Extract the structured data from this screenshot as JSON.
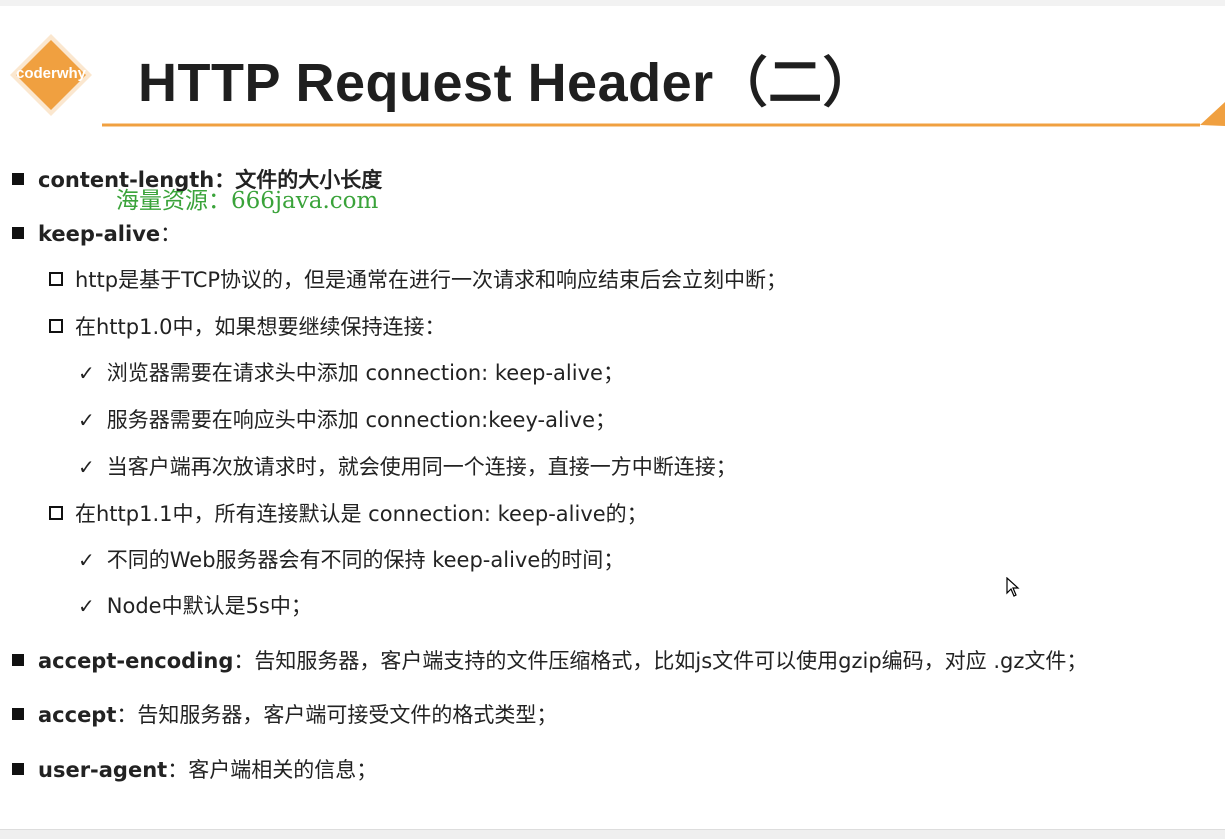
{
  "slide": {
    "logo_text": "coderwhy",
    "title": "HTTP Request Header（二）",
    "watermark": "海量资源：666java.com"
  },
  "items": {
    "content_length": {
      "key": "content-length",
      "desc": "：文件的大小长度"
    },
    "keep_alive": {
      "key": "keep-alive",
      "desc": "："
    },
    "ka_sub1": "http是基于TCP协议的，但是通常在进行一次请求和响应结束后会立刻中断；",
    "ka_sub2": "在http1.0中，如果想要继续保持连接：",
    "ka_sub2_checks": [
      "浏览器需要在请求头中添加 connection: keep-alive；",
      "服务器需要在响应头中添加 connection:keey-alive；",
      "当客户端再次放请求时，就会使用同一个连接，直接一方中断连接；"
    ],
    "ka_sub3": "在http1.1中，所有连接默认是 connection: keep-alive的；",
    "ka_sub3_checks": [
      "不同的Web服务器会有不同的保持 keep-alive的时间；",
      "Node中默认是5s中；"
    ],
    "accept_encoding": {
      "key": "accept-encoding",
      "desc": "：告知服务器，客户端支持的文件压缩格式，比如js文件可以使用gzip编码，对应 .gz文件；"
    },
    "accept": {
      "key": "accept",
      "desc": "：告知服务器，客户端可接受文件的格式类型；"
    },
    "user_agent": {
      "key": "user-agent",
      "desc": "：客户端相关的信息；"
    }
  },
  "colors": {
    "accent": "#f0a040",
    "watermark": "#3aa33a"
  },
  "check_glyph": "✓"
}
